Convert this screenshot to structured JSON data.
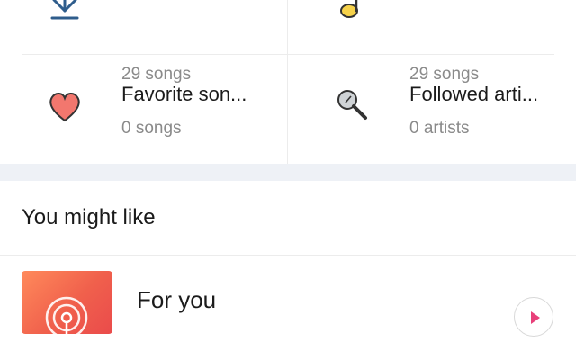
{
  "tiles": [
    {
      "icon": "download-icon",
      "title": "",
      "subtitle": "29 songs"
    },
    {
      "icon": "music-note-icon",
      "title": "",
      "subtitle": "29 songs"
    },
    {
      "icon": "heart-icon",
      "title": "Favorite son...",
      "subtitle": "0 songs"
    },
    {
      "icon": "microphone-icon",
      "title": "Followed arti...",
      "subtitle": "0 artists"
    }
  ],
  "section": {
    "title": "You might like"
  },
  "recommendation": {
    "title": "For you",
    "cover_icon": "radio-broadcast-icon",
    "action_icon": "play-icon"
  },
  "colors": {
    "accent": "#e8407a",
    "heart": "#f2776e",
    "band": "#eef1f6"
  }
}
